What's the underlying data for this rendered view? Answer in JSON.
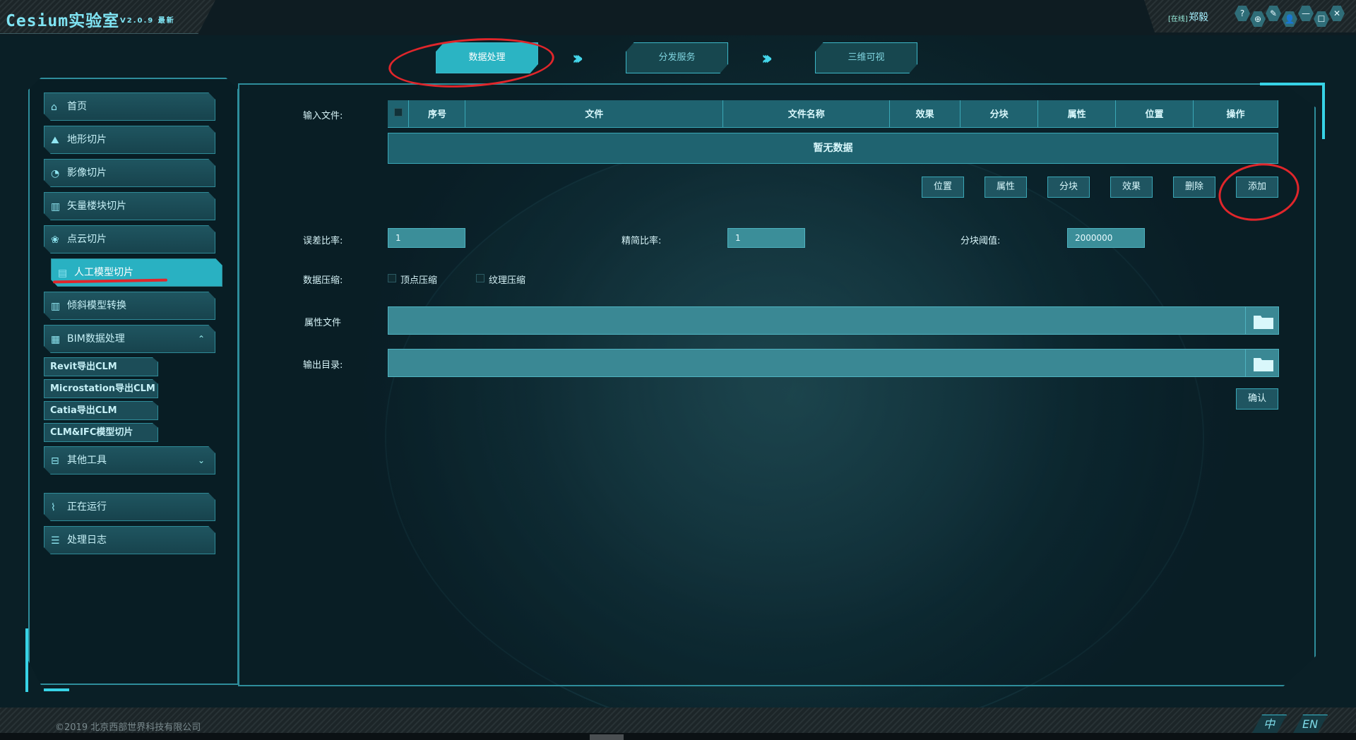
{
  "app": {
    "title": "Cesium实验室",
    "version": "V2.0.9 最新"
  },
  "user": {
    "status": "[在线]",
    "name": "郑毅"
  },
  "window_icons": [
    "help-icon",
    "plugin-icon",
    "tools-icon",
    "user-icon",
    "minimize-icon",
    "maximize-icon",
    "close-icon"
  ],
  "window_glyphs": [
    "?",
    "⊕",
    "✎",
    "👤",
    "—",
    "☐",
    "✕"
  ],
  "steps": [
    "数据处理",
    "分发服务",
    "三维可视"
  ],
  "active_step": "数据处理",
  "sidebar": {
    "items": [
      {
        "label": "首页",
        "icon": "home-icon",
        "glyph": "⌂"
      },
      {
        "label": "地形切片",
        "icon": "terrain-icon",
        "glyph": "⛰"
      },
      {
        "label": "影像切片",
        "icon": "image-icon",
        "glyph": "◔"
      },
      {
        "label": "矢量楼块切片",
        "icon": "building-icon",
        "glyph": "▥"
      },
      {
        "label": "点云切片",
        "icon": "pointcloud-icon",
        "glyph": "❀"
      },
      {
        "label": "人工模型切片",
        "icon": "model-icon",
        "glyph": "▤"
      },
      {
        "label": "倾斜模型转换",
        "icon": "oblique-icon",
        "glyph": "▥"
      },
      {
        "label": "BIM数据处理",
        "icon": "bim-icon",
        "glyph": "▦"
      }
    ],
    "active": "人工模型切片",
    "bim_sub": [
      "Revit导出CLM",
      "Microstation导出CLM",
      "Catia导出CLM",
      "CLM&IFC模型切片"
    ],
    "other_tools": {
      "label": "其他工具",
      "icon": "toolbox-icon",
      "glyph": "⊟"
    },
    "bottom": [
      {
        "label": "正在运行",
        "icon": "running-icon",
        "glyph": "⌇"
      },
      {
        "label": "处理日志",
        "icon": "log-icon",
        "glyph": "☰"
      }
    ],
    "caret_up": "⌃",
    "caret_down": "⌄"
  },
  "form": {
    "input_files_label": "输入文件:",
    "table": {
      "columns": [
        "",
        "序号",
        "文件",
        "文件名称",
        "效果",
        "分块",
        "属性",
        "位置",
        "操作"
      ],
      "empty_text": "暂无数据"
    },
    "actions": [
      "位置",
      "属性",
      "分块",
      "效果",
      "删除",
      "添加"
    ],
    "error_ratio": {
      "label": "误差比率:",
      "value": "1"
    },
    "simplify_ratio": {
      "label": "精简比率:",
      "value": "1"
    },
    "block_threshold": {
      "label": "分块阈值:",
      "value": "2000000"
    },
    "compression": {
      "label": "数据压缩:",
      "options": [
        "顶点压缩",
        "纹理压缩"
      ]
    },
    "attr_file": {
      "label": "属性文件",
      "value": ""
    },
    "output_dir": {
      "label": "输出目录:",
      "value": ""
    },
    "confirm": "确认"
  },
  "footer": {
    "copyright": "©2019 北京西部世界科技有限公司",
    "lang_zh": "中",
    "lang_en": "EN"
  },
  "colors": {
    "accent": "#2bb4c3",
    "frame": "#2e8d9b",
    "annotation": "#e0262b"
  }
}
